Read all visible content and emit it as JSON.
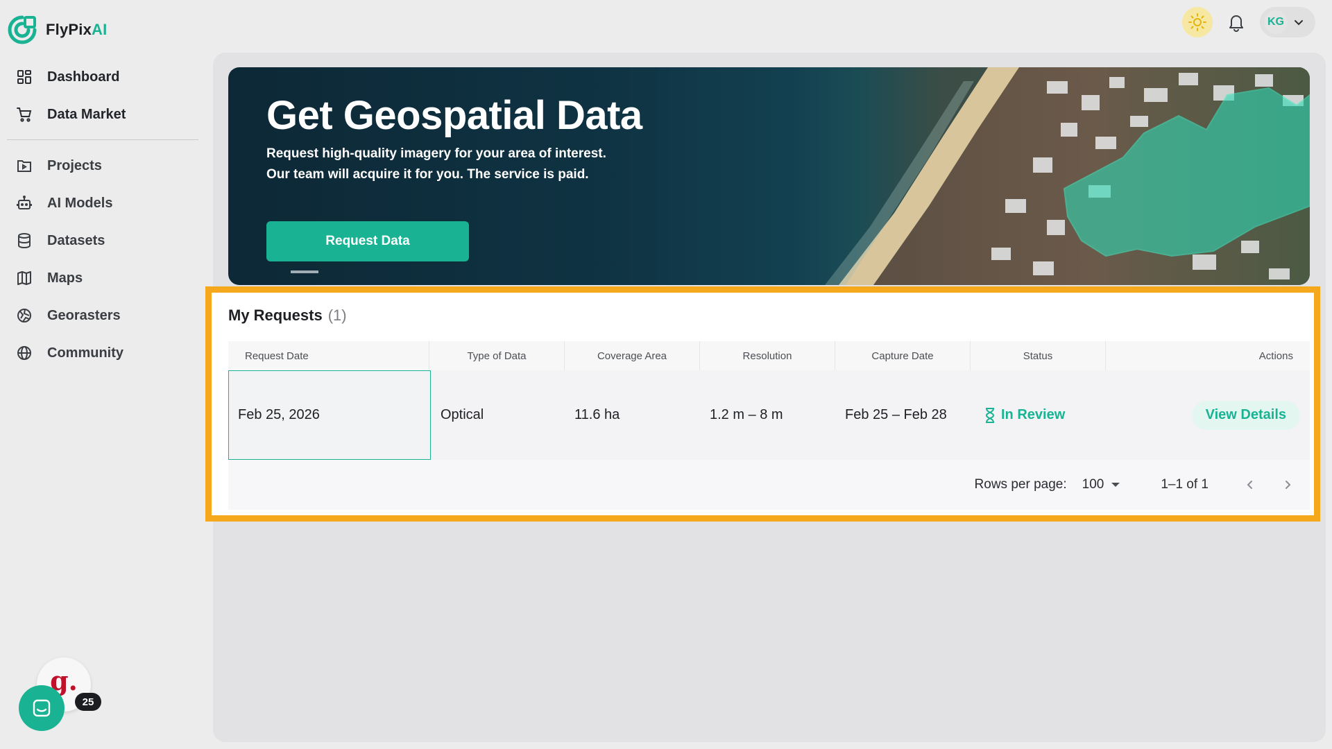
{
  "brand": {
    "name_part1": "FlyPix",
    "name_part2": "AI"
  },
  "nav": {
    "primary": [
      {
        "label": "Dashboard",
        "icon": "dashboard-icon"
      },
      {
        "label": "Data Market",
        "icon": "cart-icon"
      }
    ],
    "secondary": [
      {
        "label": "Projects",
        "icon": "folder-icon"
      },
      {
        "label": "AI Models",
        "icon": "robot-icon"
      },
      {
        "label": "Datasets",
        "icon": "database-icon"
      },
      {
        "label": "Maps",
        "icon": "map-icon"
      },
      {
        "label": "Georasters",
        "icon": "georaster-icon"
      },
      {
        "label": "Community",
        "icon": "globe-icon"
      }
    ]
  },
  "topbar": {
    "user_initials": "KG",
    "theme_icon": "sun-icon",
    "notifications_icon": "bell-icon"
  },
  "hero": {
    "title": "Get Geospatial Data",
    "subtitle_line1": "Request high-quality imagery for your area of interest.",
    "subtitle_line2": "Our team will acquire it for you. The service is paid.",
    "button_label": "Request Data"
  },
  "requests": {
    "title": "My Requests",
    "count": "(1)",
    "columns": [
      "Request Date",
      "Type of Data",
      "Coverage Area",
      "Resolution",
      "Capture Date",
      "Status",
      "Actions"
    ],
    "rows": [
      {
        "request_date": "Feb 25, 2026",
        "type": "Optical",
        "coverage": "11.6 ha",
        "resolution": "1.2 m – 8 m",
        "capture_date": "Feb 25 – Feb 28",
        "status": "In Review",
        "action": "View Details"
      }
    ],
    "pagination": {
      "rows_per_page_label": "Rows per page:",
      "rows_per_page": "100",
      "range": "1–1 of 1"
    }
  },
  "widgets": {
    "g_letter": "g.",
    "g_count": "25"
  },
  "colors": {
    "accent": "#19b394",
    "highlight": "#f6a81c",
    "hero_bg": "#0f3343"
  }
}
